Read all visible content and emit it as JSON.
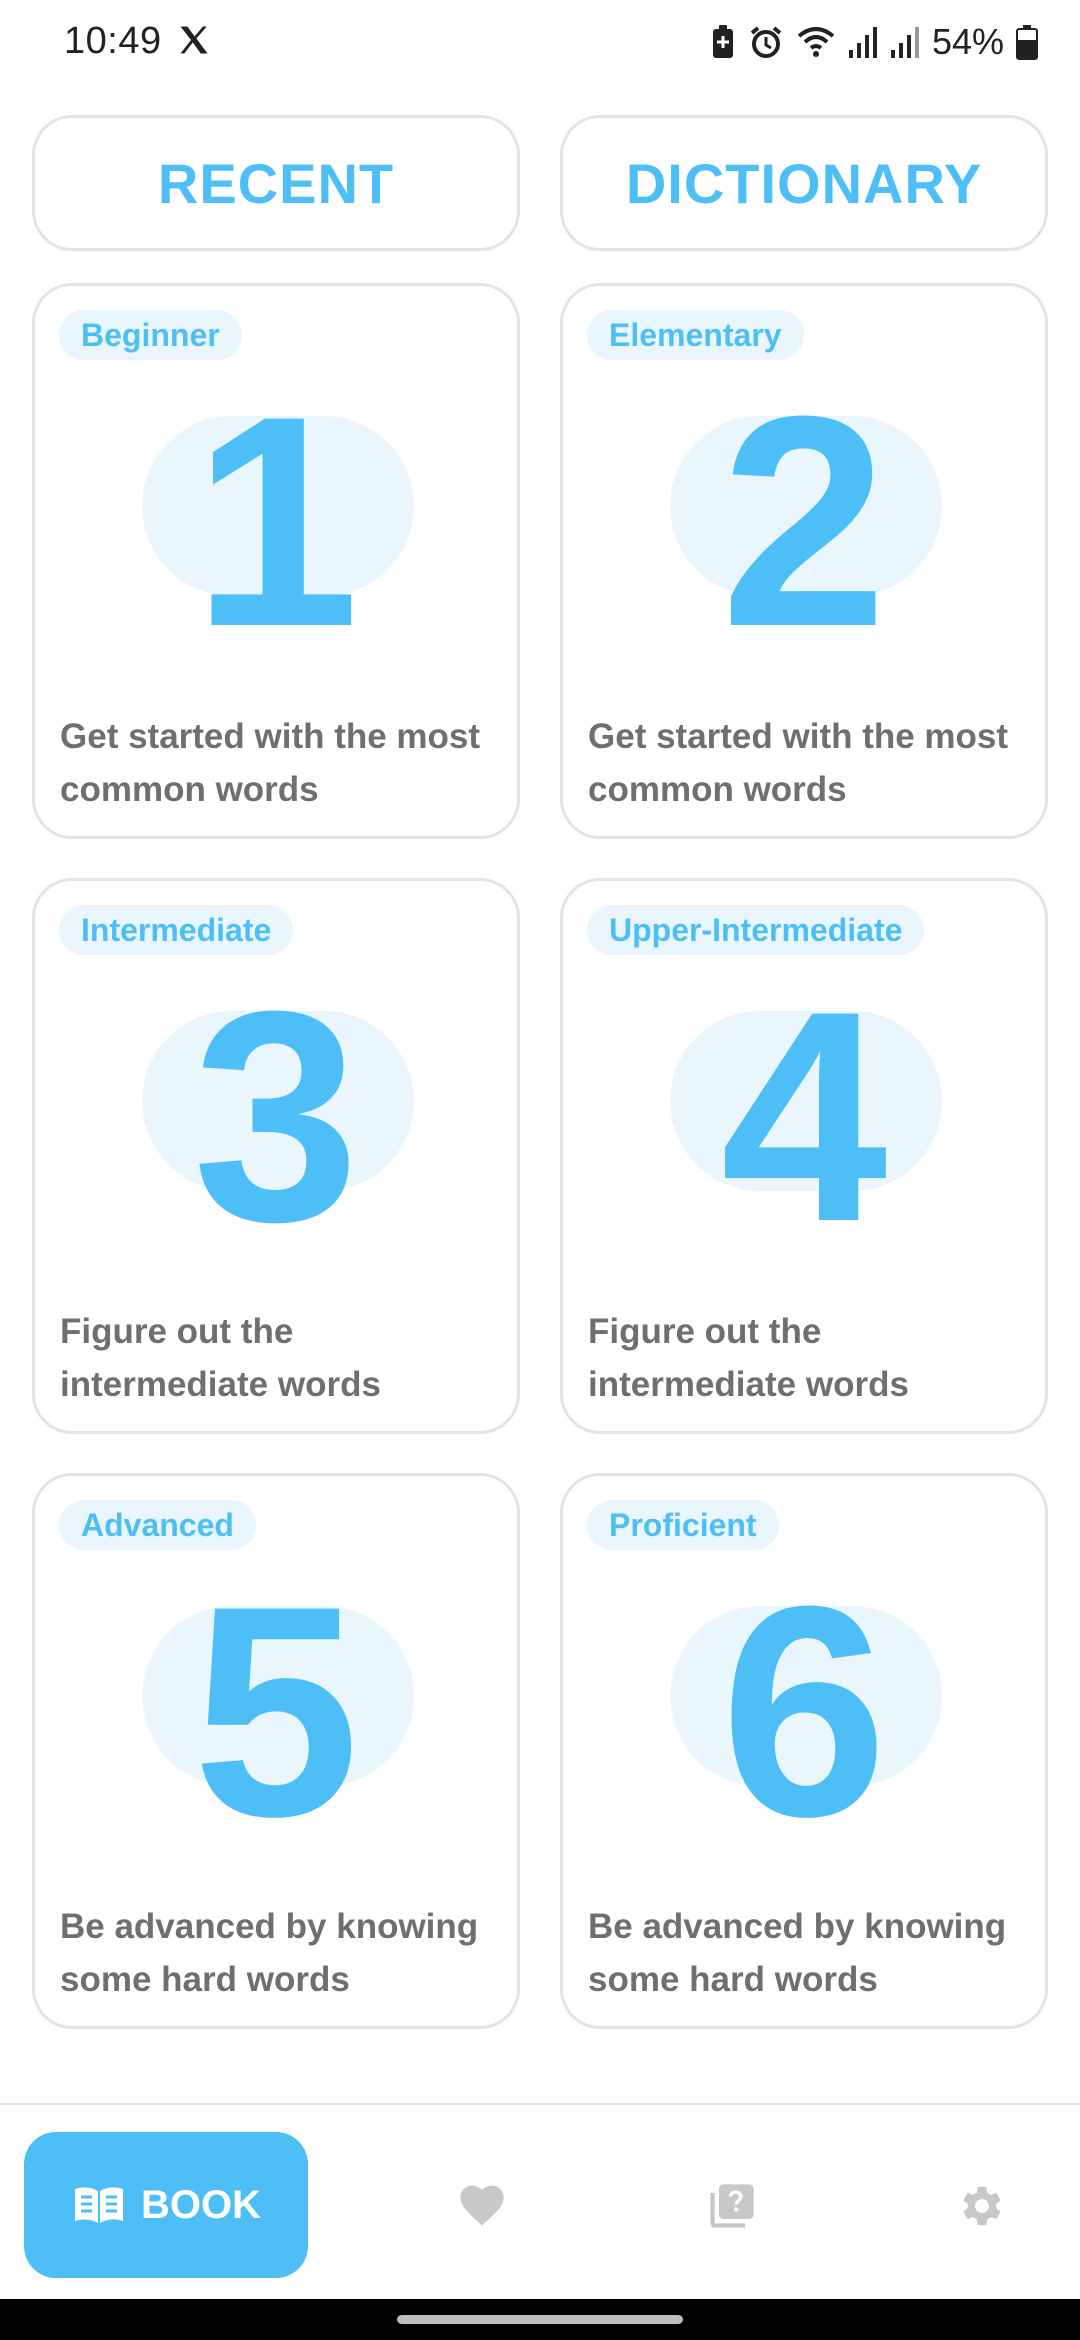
{
  "status_bar": {
    "time": "10:49",
    "battery_percent": "54%",
    "icons": [
      "x-logo-icon",
      "battery-saver-icon",
      "alarm-icon",
      "wifi-icon",
      "signal-icon",
      "signal-icon-2",
      "battery-icon"
    ]
  },
  "top_buttons": {
    "recent_label": "RECENT",
    "dictionary_label": "DICTIONARY"
  },
  "levels": [
    {
      "tag": "Beginner",
      "number": "1",
      "description": "Get started with the most common words"
    },
    {
      "tag": "Elementary",
      "number": "2",
      "description": "Get started with the most common words"
    },
    {
      "tag": "Intermediate",
      "number": "3",
      "description": "Figure out the intermediate words"
    },
    {
      "tag": "Upper-Intermediate",
      "number": "4",
      "description": "Figure out the intermediate words"
    },
    {
      "tag": "Advanced",
      "number": "5",
      "description": "Be advanced by knowing some hard words"
    },
    {
      "tag": "Proficient",
      "number": "6",
      "description": "Be advanced by knowing some hard words"
    }
  ],
  "bottom_nav": {
    "active_label": "BOOK",
    "items": [
      "book-icon",
      "heart-icon",
      "quiz-icon",
      "gear-icon"
    ]
  },
  "colors": {
    "accent": "#4dbff6",
    "accent_light": "#eaf6fd",
    "text_muted": "#6f6f6f",
    "border": "#e3e3e3",
    "inactive_icon": "#c8c8c8"
  }
}
